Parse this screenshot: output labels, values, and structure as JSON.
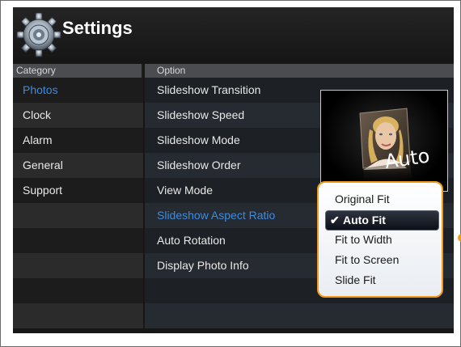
{
  "header": {
    "title": "Settings",
    "icon": "gear-icon"
  },
  "columns": {
    "category": "Category",
    "option": "Option"
  },
  "categories": [
    "Photos",
    "Clock",
    "Alarm",
    "General",
    "Support"
  ],
  "options": [
    "Slideshow Transition",
    "Slideshow Speed",
    "Slideshow Mode",
    "Slideshow Order",
    "View Mode",
    "Slideshow Aspect Ratio",
    "Auto Rotation",
    "Display Photo Info"
  ],
  "preview": {
    "label": "Auto"
  },
  "popup": {
    "items": [
      "Original Fit",
      "Auto Fit",
      "Fit to Width",
      "Fit to Screen",
      "Slide Fit"
    ],
    "selected": "Auto Fit",
    "check": "✔"
  },
  "colors": {
    "accent": "#3c8be0",
    "highlight": "#f39a1c"
  }
}
